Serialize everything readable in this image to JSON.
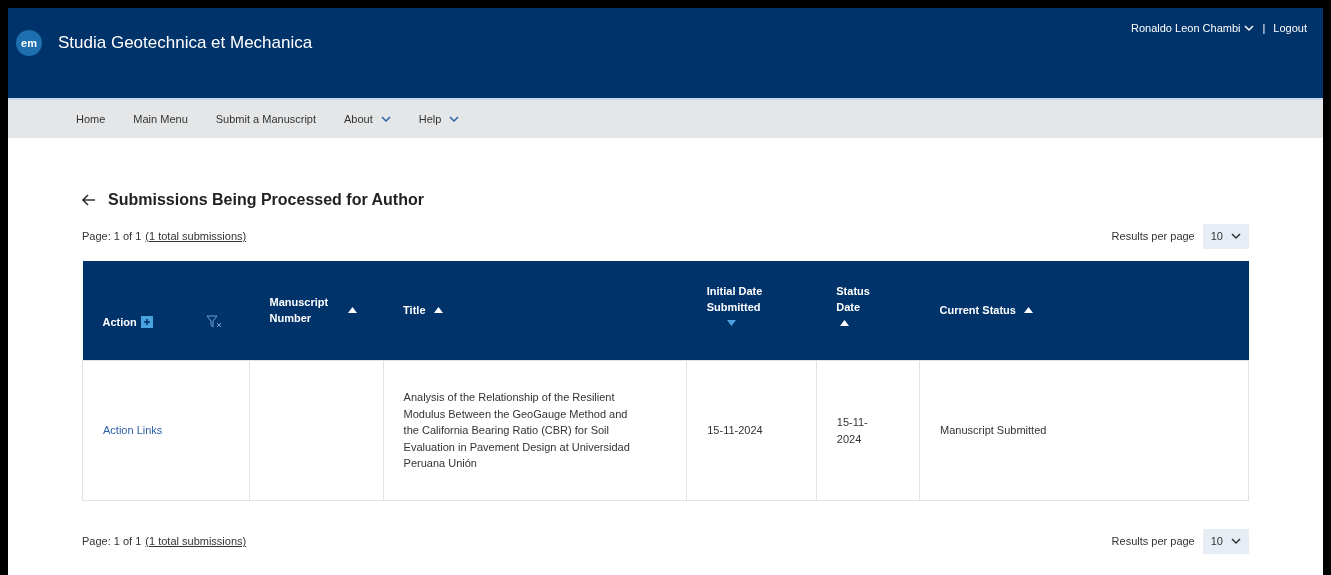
{
  "header": {
    "logo": "em",
    "title": "Studia Geotechnica et Mechanica",
    "user": "Ronaldo Leon Chambi",
    "separator": "|",
    "logout": "Logout"
  },
  "nav": [
    {
      "label": "Home",
      "dropdown": false
    },
    {
      "label": "Main Menu",
      "dropdown": false
    },
    {
      "label": "Submit a Manuscript",
      "dropdown": false
    },
    {
      "label": "About",
      "dropdown": true
    },
    {
      "label": "Help",
      "dropdown": true
    }
  ],
  "page_title": "Submissions Being Processed for Author",
  "pagination_top": {
    "page": "Page: 1 of 1",
    "total_link": "(1 total submissions)",
    "results_label": "Results per page",
    "results_value": "10"
  },
  "table": {
    "columns": [
      {
        "label": "Action",
        "kind": "action"
      },
      {
        "label": "Manuscript Number",
        "kind": "text",
        "descending": false
      },
      {
        "label": "Title",
        "kind": "text",
        "descending": false
      },
      {
        "label": "Initial Date Submitted",
        "kind": "stacked",
        "descending": true
      },
      {
        "label": "Status Date",
        "kind": "stacked",
        "descending": false
      },
      {
        "label": "Current Status",
        "kind": "text",
        "descending": false
      }
    ],
    "rows": [
      {
        "cells": [
          "Action Links",
          "",
          "Analysis of the Relationship of the Resilient Modulus Between the GeoGauge Method and the California Bearing Ratio (CBR) for Soil Evaluation in Pavement Design at Universidad Peruana Unión",
          "15-11-2024",
          "15-11-2024",
          "Manuscript Submitted"
        ]
      }
    ]
  },
  "pagination_bottom": {
    "page": "Page: 1 of 1",
    "total_link": "(1 total submissions)",
    "results_label": "Results per page",
    "results_value": "10"
  }
}
